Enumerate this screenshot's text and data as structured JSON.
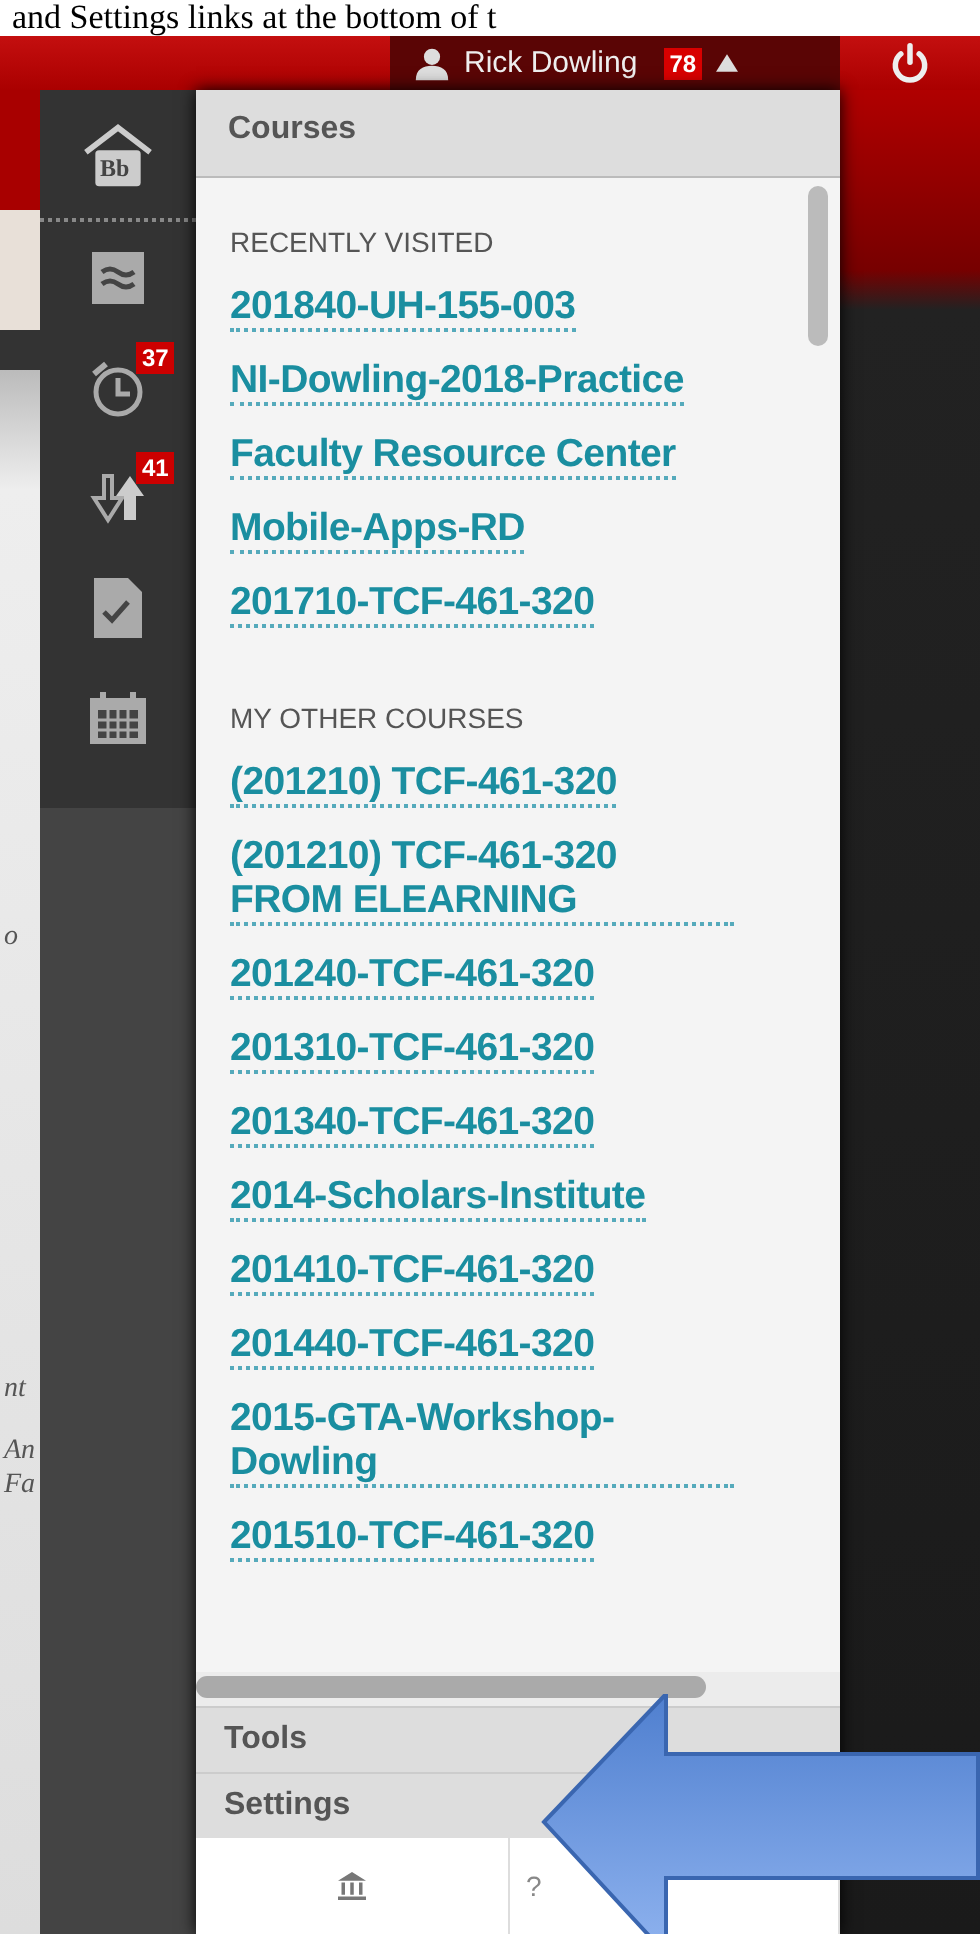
{
  "document_caption": "and Settings links at the bottom of t",
  "top_bar": {
    "user_name": "Rick Dowling",
    "notification_count": "78"
  },
  "background_fragments": [
    "o",
    "nt",
    "An",
    "Fa"
  ],
  "sidebar": {
    "items": [
      {
        "kind": "home",
        "logo_text": "Bb"
      },
      {
        "kind": "stream"
      },
      {
        "kind": "due",
        "badge": "37"
      },
      {
        "kind": "grades",
        "badge": "41"
      },
      {
        "kind": "assignments"
      },
      {
        "kind": "calendar"
      }
    ]
  },
  "menu": {
    "title": "Courses",
    "sections": [
      {
        "heading": "RECENTLY VISITED",
        "links": [
          "201840-UH-155-003",
          "NI-Dowling-2018-Practice",
          "Faculty Resource Center",
          "Mobile-Apps-RD",
          "201710-TCF-461-320"
        ]
      },
      {
        "heading": "MY OTHER COURSES",
        "links": [
          "(201210) TCF-461-320",
          "(201210) TCF-461-320 FROM ELEARNING",
          "201240-TCF-461-320",
          "201310-TCF-461-320",
          "201340-TCF-461-320",
          "2014-Scholars-Institute",
          "201410-TCF-461-320",
          "201440-TCF-461-320",
          "2015-GTA-Workshop-Dowling",
          "201510-TCF-461-320"
        ]
      }
    ],
    "bottom_items": [
      "Tools",
      "Settings"
    ],
    "footer": {
      "help_label": "?"
    }
  }
}
